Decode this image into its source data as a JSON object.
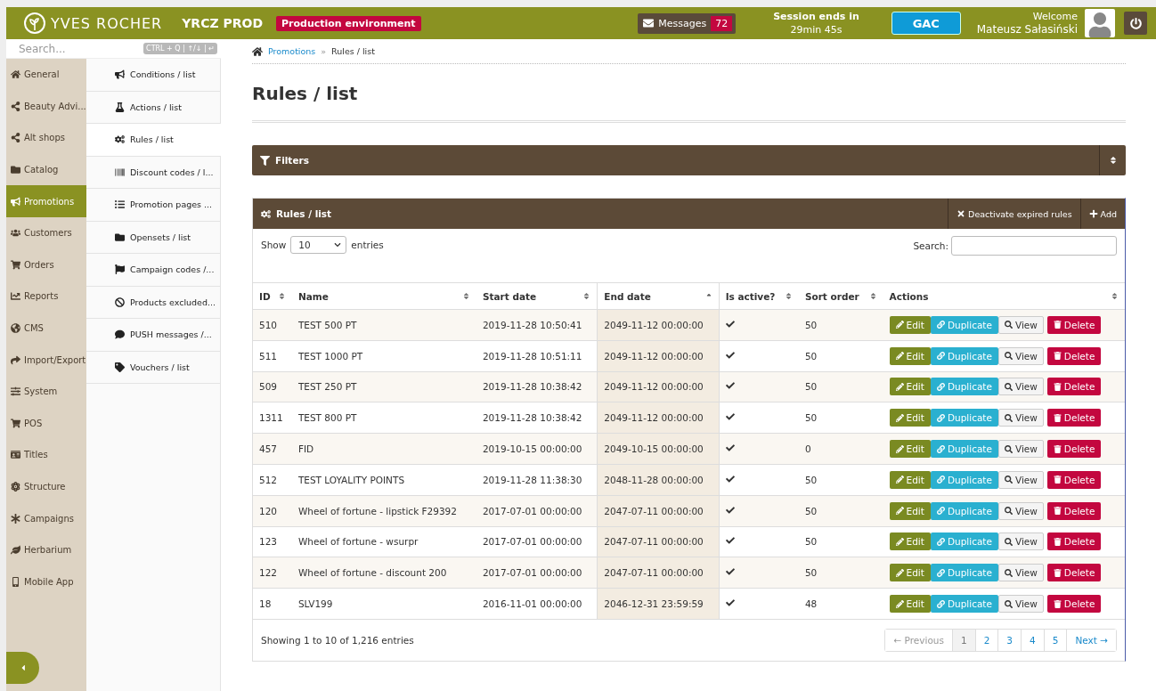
{
  "header": {
    "brand": "YVES ROCHER",
    "env_name": "YRCZ PROD",
    "env_badge": "Production environment",
    "messages": {
      "label": "Messages",
      "count": "72"
    },
    "session": {
      "label": "Session ends in",
      "time": "29min 45s"
    },
    "company_button": "GAC",
    "welcome": "Welcome",
    "user": "Mateusz Sałasiński"
  },
  "sidebar": {
    "search_placeholder": "Search...",
    "shortcut": "CTRL + Q | ↑/↓ | ↵",
    "items": [
      {
        "label": "General",
        "selected": false
      },
      {
        "label": "Beauty Advi...",
        "selected": false
      },
      {
        "label": "Alt shops",
        "selected": false
      },
      {
        "label": "Catalog",
        "selected": false
      },
      {
        "label": "Promotions",
        "selected": true
      },
      {
        "label": "Customers",
        "selected": false
      },
      {
        "label": "Orders",
        "selected": false
      },
      {
        "label": "Reports",
        "selected": false
      },
      {
        "label": "CMS",
        "selected": false
      },
      {
        "label": "Import/Export",
        "selected": false
      },
      {
        "label": "System",
        "selected": false
      },
      {
        "label": "POS",
        "selected": false
      },
      {
        "label": "Titles",
        "selected": false
      },
      {
        "label": "Structure",
        "selected": false
      },
      {
        "label": "Campaigns",
        "selected": false
      },
      {
        "label": "Herbarium",
        "selected": false
      },
      {
        "label": "Mobile App",
        "selected": false
      }
    ]
  },
  "submenu": [
    {
      "label": "Conditions / list",
      "selected": false
    },
    {
      "label": "Actions / list",
      "selected": false
    },
    {
      "label": "Rules / list",
      "selected": true
    },
    {
      "label": "Discount codes / l...",
      "selected": false
    },
    {
      "label": "Promotion pages ...",
      "selected": false
    },
    {
      "label": "Opensets / list",
      "selected": false
    },
    {
      "label": "Campaign codes /...",
      "selected": false
    },
    {
      "label": "Products excluded...",
      "selected": false
    },
    {
      "label": "PUSH messages /...",
      "selected": false
    },
    {
      "label": "Vouchers / list",
      "selected": false
    }
  ],
  "breadcrumb": {
    "link": "Promotions",
    "separator": "»",
    "current": "Rules / list"
  },
  "page_title": "Rules / list",
  "filters": {
    "title": "Filters"
  },
  "panel": {
    "title": "Rules / list",
    "actions": [
      "Deactivate expired rules",
      "Add"
    ],
    "show_label": "Show",
    "page_size": "10",
    "entries_label": "entries",
    "search_label": "Search:",
    "columns": [
      {
        "label": "ID",
        "sorted": false
      },
      {
        "label": "Name",
        "sorted": false
      },
      {
        "label": "Start date",
        "sorted": false
      },
      {
        "label": "End date",
        "sorted": true
      },
      {
        "label": "Is active?",
        "sorted": false
      },
      {
        "label": "Sort order",
        "sorted": false
      },
      {
        "label": "Actions",
        "sorted": false
      }
    ],
    "rows": [
      {
        "id": "510",
        "name": "TEST 500 PT",
        "start": "2019-11-28 10:50:41",
        "end": "2049-11-12 00:00:00",
        "active": true,
        "sort": "50",
        "buttons": [
          "Edit",
          "Duplicate",
          "View",
          "Delete"
        ]
      },
      {
        "id": "511",
        "name": "TEST 1000 PT",
        "start": "2019-11-28 10:51:11",
        "end": "2049-11-12 00:00:00",
        "active": true,
        "sort": "50",
        "buttons": [
          "Edit",
          "Duplicate",
          "View",
          "Delete"
        ]
      },
      {
        "id": "509",
        "name": "TEST 250 PT",
        "start": "2019-11-28 10:38:42",
        "end": "2049-11-12 00:00:00",
        "active": true,
        "sort": "50",
        "buttons": [
          "Edit",
          "Duplicate",
          "View",
          "Delete"
        ]
      },
      {
        "id": "1311",
        "name": "TEST 800 PT",
        "start": "2019-11-28 10:38:42",
        "end": "2049-11-12 00:00:00",
        "active": true,
        "sort": "50",
        "buttons": [
          "Edit",
          "Duplicate",
          "View",
          "Delete"
        ]
      },
      {
        "id": "457",
        "name": "FID",
        "start": "2019-10-15 00:00:00",
        "end": "2049-10-15 00:00:00",
        "active": true,
        "sort": "0",
        "buttons": [
          "Edit",
          "Duplicate",
          "View",
          "Delete"
        ]
      },
      {
        "id": "512",
        "name": "TEST LOYALITY POINTS",
        "start": "2019-11-28 11:38:30",
        "end": "2048-11-28 00:00:00",
        "active": true,
        "sort": "50",
        "buttons": [
          "Edit",
          "Duplicate",
          "View",
          "Delete"
        ]
      },
      {
        "id": "120",
        "name": "Wheel of fortune - lipstick F29392",
        "start": "2017-07-01 00:00:00",
        "end": "2047-07-11 00:00:00",
        "active": true,
        "sort": "50",
        "buttons": [
          "Edit",
          "Duplicate",
          "View",
          "Delete"
        ]
      },
      {
        "id": "123",
        "name": "Wheel of fortune - wsurpr",
        "start": "2017-07-01 00:00:00",
        "end": "2047-07-11 00:00:00",
        "active": true,
        "sort": "50",
        "buttons": [
          "Edit",
          "Duplicate",
          "View",
          "Delete"
        ]
      },
      {
        "id": "122",
        "name": "Wheel of fortune - discount 200",
        "start": "2017-07-01 00:00:00",
        "end": "2047-07-11 00:00:00",
        "active": true,
        "sort": "50",
        "buttons": [
          "Edit",
          "Duplicate",
          "View",
          "Delete"
        ]
      },
      {
        "id": "18",
        "name": "SLV199",
        "start": "2016-11-01 00:00:00",
        "end": "2046-12-31 23:59:59",
        "active": true,
        "sort": "48",
        "buttons": [
          "Edit",
          "Duplicate",
          "View",
          "Delete"
        ]
      }
    ],
    "info": "Showing 1 to 10 of 1,216 entries",
    "pagination": [
      {
        "label": "← Previous",
        "disabled": true,
        "selected": false
      },
      {
        "label": "1",
        "disabled": false,
        "selected": true
      },
      {
        "label": "2",
        "disabled": false,
        "selected": false
      },
      {
        "label": "3",
        "disabled": false,
        "selected": false
      },
      {
        "label": "4",
        "disabled": false,
        "selected": false
      },
      {
        "label": "5",
        "disabled": false,
        "selected": false
      },
      {
        "label": "Next →",
        "disabled": false,
        "selected": false
      }
    ]
  }
}
